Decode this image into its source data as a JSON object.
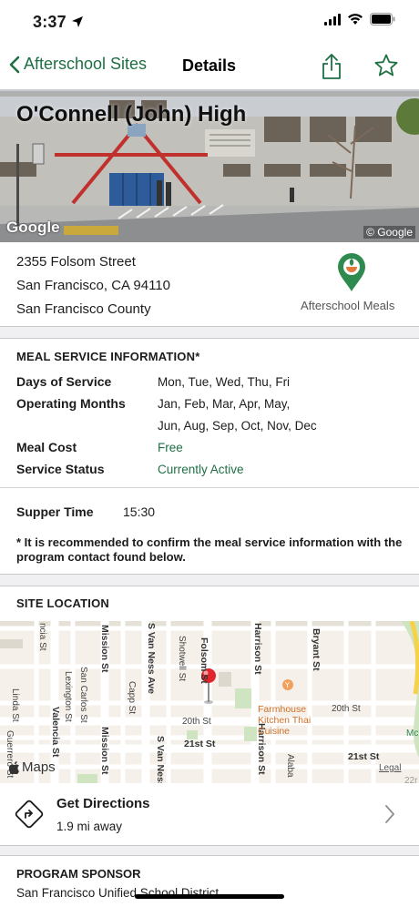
{
  "status_bar": {
    "time": "3:37"
  },
  "nav": {
    "back_label": "Afterschool Sites",
    "title": "Details"
  },
  "hero": {
    "site_name": "O'Connell (John) High",
    "google_logo": "Google",
    "copyright": "© Google"
  },
  "address": {
    "street": "2355 Folsom Street",
    "city_line": "San Francisco, CA 94110",
    "county": "San Francisco County",
    "program_label": "Afterschool Meals"
  },
  "meal_info": {
    "heading": "MEAL SERVICE INFORMATION*",
    "days_label": "Days of Service",
    "days_value": "Mon, Tue, Wed, Thu, Fri",
    "months_label": "Operating Months",
    "months_line1": "Jan, Feb, Mar, Apr, May,",
    "months_line2": "Jun, Aug, Sep, Oct, Nov, Dec",
    "cost_label": "Meal Cost",
    "cost_value": "Free",
    "status_label": "Service Status",
    "status_value": "Currently Active",
    "supper_label": "Supper Time",
    "supper_value": "15:30",
    "note": "* It is recommended to confirm the meal service information with the program contact found below."
  },
  "location": {
    "heading": "SITE LOCATION",
    "streets": {
      "ncia": "ncia St",
      "valencia": "Valencia St",
      "linda": "Linda St",
      "guerrero": "Guerrero St",
      "lexington": "Lexington St",
      "san_carlos": "San Carlos St",
      "mission_top": "Mission St",
      "mission_bottom": "Mission St",
      "capp": "Capp St",
      "van_ness_top": "S Van Ness Ave",
      "van_ness_bottom": "S Van Ness",
      "shotwell": "Shotwell St",
      "folsom": "Folsom St",
      "harrison_top": "Harrison St",
      "harrison_bottom": "Harrison St",
      "bryant": "Bryant St",
      "twentieth_left": "20th St",
      "twentieth_right": "20th St",
      "twentyfirst_left": "21st St",
      "twentyfirst_right": "21st St",
      "alabama": "Alaba",
      "mc": "Mc",
      "twentytwo": "22r"
    },
    "poi": {
      "line1": "Farmhouse",
      "line2": "Kitchen Thai",
      "line3": "Cuisine"
    },
    "maps_logo": "Maps",
    "legal": "Legal"
  },
  "directions": {
    "title": "Get Directions",
    "distance": "1.9 mi away"
  },
  "sponsor": {
    "heading": "PROGRAM SPONSOR",
    "name": "San Francisco Unified School District"
  },
  "colors": {
    "accent": "#1f6f43",
    "pin": "#e0262b",
    "poi": "#d27028"
  }
}
